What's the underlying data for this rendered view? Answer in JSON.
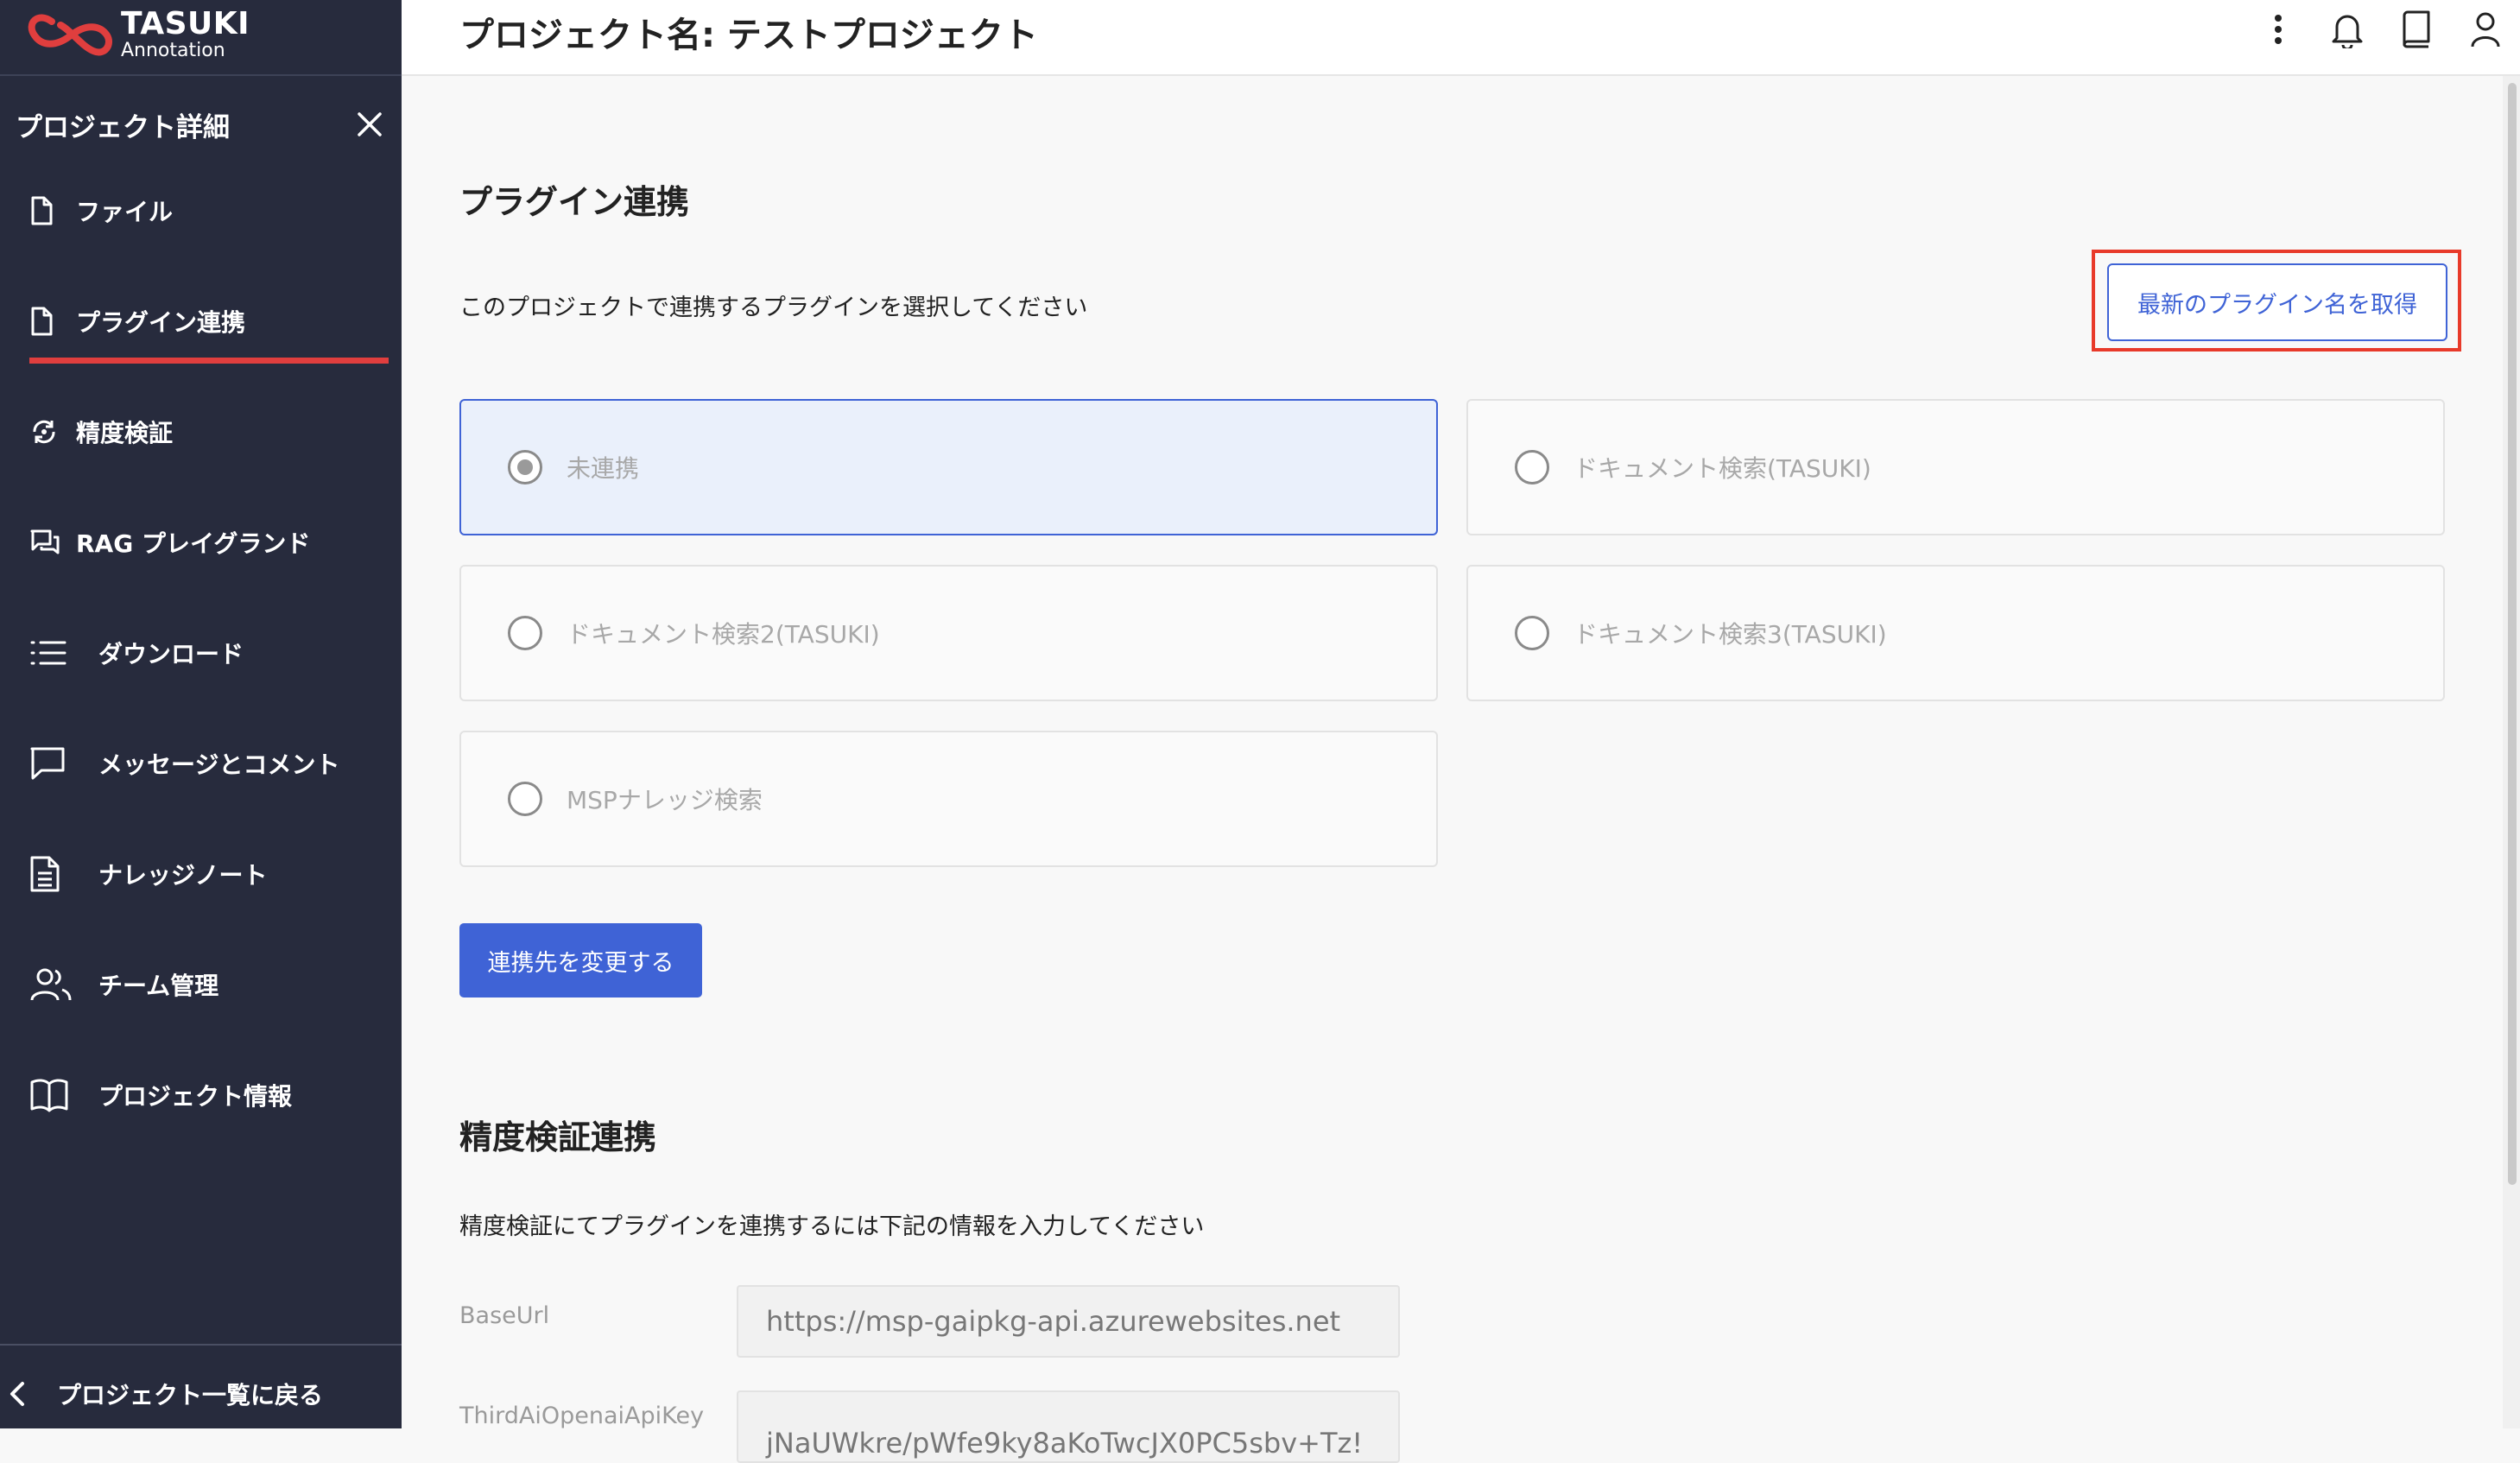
{
  "brand": {
    "title": "TASUKI",
    "subtitle": "Annotation"
  },
  "sidebar": {
    "header_title": "プロジェクト詳細",
    "items": [
      {
        "label": "ファイル",
        "icon": "file-icon"
      },
      {
        "label": "プラグイン連携",
        "icon": "file-icon",
        "active": true
      },
      {
        "label": "精度検証",
        "icon": "accuracy-icon"
      },
      {
        "label": "RAG プレイグランド",
        "icon": "chat-icon"
      },
      {
        "label": "ダウンロード",
        "icon": "list-icon"
      },
      {
        "label": "メッセージとコメント",
        "icon": "message-icon"
      },
      {
        "label": "ナレッジノート",
        "icon": "document-icon"
      },
      {
        "label": "チーム管理",
        "icon": "team-icon"
      },
      {
        "label": "プロジェクト情報",
        "icon": "book-icon"
      }
    ],
    "back_label": "プロジェクト一覧に戻る"
  },
  "header": {
    "title": "プロジェクト名: テストプロジェクト"
  },
  "plugin": {
    "heading": "プラグイン連携",
    "description": "このプロジェクトで連携するプラグインを選択してください",
    "fetch_button": "最新のプラグイン名を取得",
    "options": [
      {
        "label": "未連携",
        "selected": true
      },
      {
        "label": "ドキュメント検索(TASUKI)",
        "selected": false
      },
      {
        "label": "ドキュメント検索2(TASUKI)",
        "selected": false
      },
      {
        "label": "ドキュメント検索3(TASUKI)",
        "selected": false
      },
      {
        "label": "MSPナレッジ検索",
        "selected": false
      }
    ],
    "change_button": "連携先を変更する"
  },
  "accuracy": {
    "heading": "精度検証連携",
    "description": "精度検証にてプラグインを連携するには下記の情報を入力してください",
    "fields": [
      {
        "label": "BaseUrl",
        "value": "https://msp-gaipkg-api.azurewebsites.net"
      },
      {
        "label": "ThirdAiOpenaiApiKey",
        "value": "jNaUWkre/pWfe9ky8aKoTwcJX0PC5sbv+Tz!"
      }
    ]
  },
  "colors": {
    "sidebar_bg": "#272b3d",
    "accent": "#3f63d6",
    "active_underline": "#e03e3e",
    "highlight_box": "#e83a2a"
  }
}
